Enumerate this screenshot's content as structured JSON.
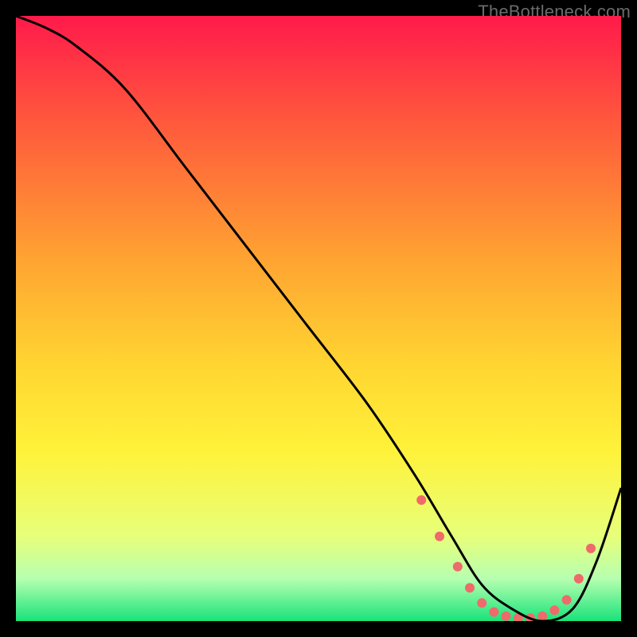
{
  "watermark": "TheBottleneck.com",
  "chart_data": {
    "type": "line",
    "title": "",
    "xlabel": "",
    "ylabel": "",
    "xlim": [
      0,
      100
    ],
    "ylim": [
      0,
      100
    ],
    "grid": false,
    "legend": false,
    "gradient_stops": [
      {
        "offset": 0,
        "color": "#ff1a4b"
      },
      {
        "offset": 0.18,
        "color": "#ff5a3c"
      },
      {
        "offset": 0.4,
        "color": "#ffa332"
      },
      {
        "offset": 0.58,
        "color": "#ffd631"
      },
      {
        "offset": 0.72,
        "color": "#fff23a"
      },
      {
        "offset": 0.86,
        "color": "#e7ff7a"
      },
      {
        "offset": 0.93,
        "color": "#b6ffb0"
      },
      {
        "offset": 1.0,
        "color": "#19e37a"
      }
    ],
    "series": [
      {
        "name": "bottleneck-curve",
        "color": "#000000",
        "x": [
          0,
          5,
          10,
          18,
          28,
          38,
          48,
          58,
          66,
          72,
          77,
          82,
          87,
          92,
          96,
          100
        ],
        "y": [
          100,
          98,
          95,
          88,
          75,
          62,
          49,
          36,
          24,
          14,
          6,
          2,
          0,
          2,
          10,
          22
        ]
      }
    ],
    "markers": {
      "name": "valley-dots",
      "color": "#ef6a6a",
      "radius": 6,
      "x": [
        67,
        70,
        73,
        75,
        77,
        79,
        81,
        83,
        85,
        87,
        89,
        91,
        93,
        95
      ],
      "y": [
        20,
        14,
        9,
        5.5,
        3,
        1.5,
        0.8,
        0.5,
        0.5,
        0.8,
        1.8,
        3.5,
        7,
        12
      ]
    }
  }
}
